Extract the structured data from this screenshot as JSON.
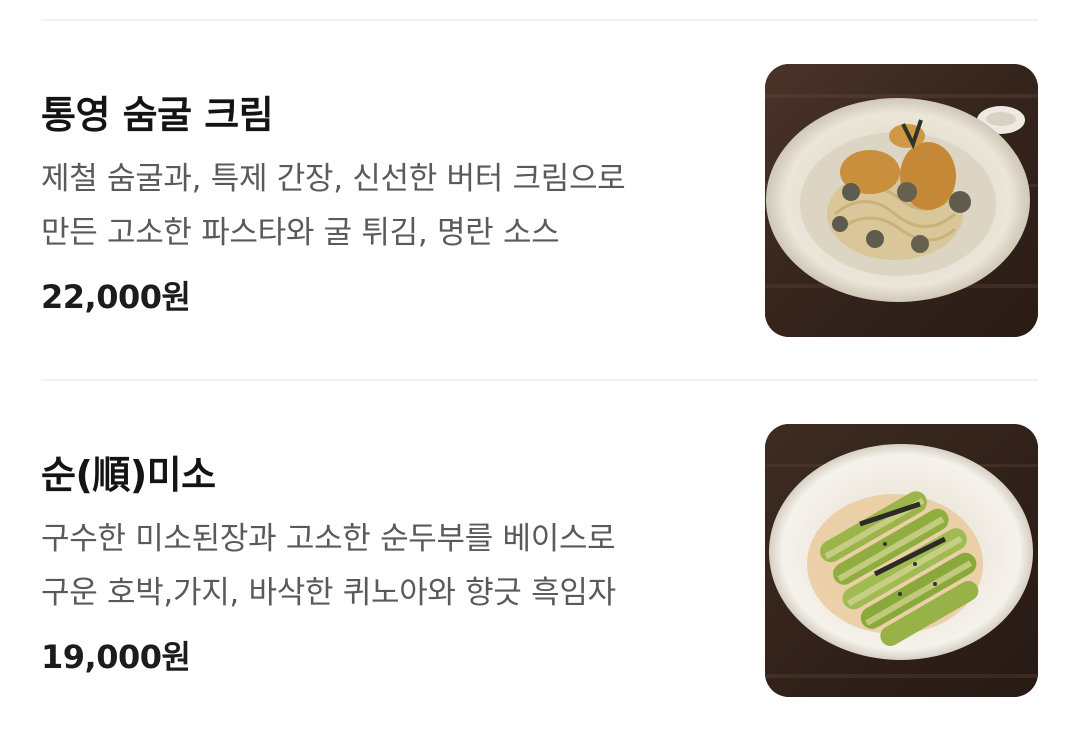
{
  "menu": {
    "items": [
      {
        "title": "통영 숨굴 크림",
        "desc_line1": "제철 숨굴과, 특제 간장, 신선한 버터 크림으로",
        "desc_line2": "만든 고소한 파스타와 굴 튀김, 명란 소스",
        "price": "22,000원",
        "image_icon": "oyster-cream-pasta-photo"
      },
      {
        "title": "순(順)미소",
        "desc_line1": "구수한 미소된장과 고소한 순두부를 베이스로",
        "desc_line2": "구운 호박,가지, 바삭한 퀴노아와 향긋 흑임자",
        "price": "19,000원",
        "image_icon": "miso-zucchini-pasta-photo"
      }
    ]
  },
  "colors": {
    "title": "#141414",
    "description": "#5a5a5a",
    "price": "#1c1c1c",
    "divider": "#f1f1f1",
    "table_wood": "#3b2a20",
    "plate": "#e9e2d4"
  }
}
